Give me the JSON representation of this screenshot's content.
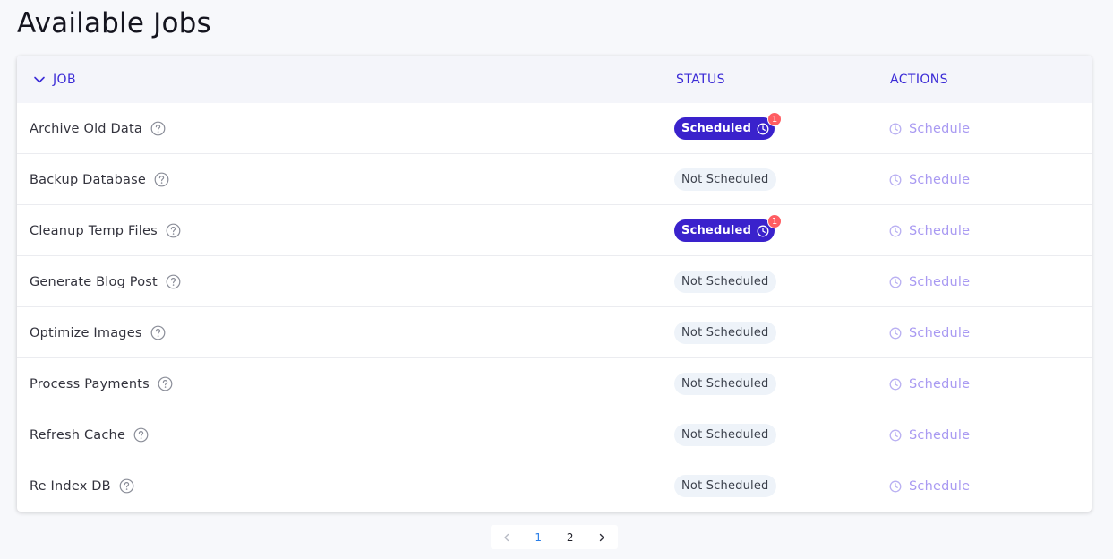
{
  "page": {
    "title": "Available Jobs"
  },
  "table": {
    "headers": {
      "job": "JOB",
      "status": "STATUS",
      "actions": "ACTIONS"
    },
    "rows": [
      {
        "name": "Archive Old Data",
        "status": "Scheduled",
        "scheduled": true,
        "count": "1",
        "action": "Schedule"
      },
      {
        "name": "Backup Database",
        "status": "Not Scheduled",
        "scheduled": false,
        "count": "",
        "action": "Schedule"
      },
      {
        "name": "Cleanup Temp Files",
        "status": "Scheduled",
        "scheduled": true,
        "count": "1",
        "action": "Schedule"
      },
      {
        "name": "Generate Blog Post",
        "status": "Not Scheduled",
        "scheduled": false,
        "count": "",
        "action": "Schedule"
      },
      {
        "name": "Optimize Images",
        "status": "Not Scheduled",
        "scheduled": false,
        "count": "",
        "action": "Schedule"
      },
      {
        "name": "Process Payments",
        "status": "Not Scheduled",
        "scheduled": false,
        "count": "",
        "action": "Schedule"
      },
      {
        "name": "Refresh Cache",
        "status": "Not Scheduled",
        "scheduled": false,
        "count": "",
        "action": "Schedule"
      },
      {
        "name": "Re Index DB",
        "status": "Not Scheduled",
        "scheduled": false,
        "count": "",
        "action": "Schedule"
      }
    ]
  },
  "pagination": {
    "pages": [
      "1",
      "2"
    ],
    "current": "1"
  },
  "icons": {
    "sort": "chevron-down-icon",
    "help": "help-circle-icon",
    "clock": "clock-icon",
    "prev": "chevron-left-icon",
    "next": "chevron-right-icon"
  },
  "colors": {
    "accent": "#3b2bd6",
    "scheduled_badge": "#3a22cc",
    "count_badge": "#ff5d62",
    "action_text": "#a99af2",
    "page_current": "#2a7ee8"
  }
}
